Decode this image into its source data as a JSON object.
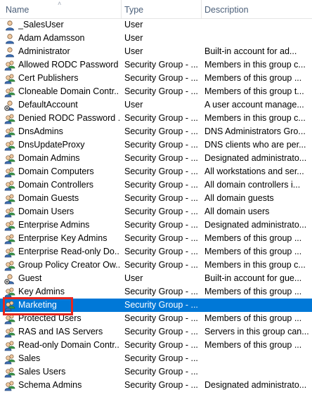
{
  "columns": {
    "name": "Name",
    "type": "Type",
    "description": "Description"
  },
  "colors": {
    "selection": "#0078d7",
    "highlight": "#e8261e",
    "header_text": "#4c607a"
  },
  "rows": [
    {
      "name": "_SalesUser",
      "type": "User",
      "description": "",
      "icon": "user-icon"
    },
    {
      "name": "Adam Adamsson",
      "type": "User",
      "description": "",
      "icon": "user-icon"
    },
    {
      "name": "Administrator",
      "type": "User",
      "description": "Built-in account for ad...",
      "icon": "user-icon"
    },
    {
      "name": "Allowed RODC Password ...",
      "type": "Security Group - ...",
      "description": "Members in this group c...",
      "icon": "group-icon"
    },
    {
      "name": "Cert Publishers",
      "type": "Security Group - ...",
      "description": "Members of this group ...",
      "icon": "group-icon"
    },
    {
      "name": "Cloneable Domain Contr...",
      "type": "Security Group - ...",
      "description": "Members of this group t...",
      "icon": "group-icon"
    },
    {
      "name": "DefaultAccount",
      "type": "User",
      "description": "A user account manage...",
      "icon": "user-disabled-icon"
    },
    {
      "name": "Denied RODC Password ...",
      "type": "Security Group - ...",
      "description": "Members in this group c...",
      "icon": "group-icon"
    },
    {
      "name": "DnsAdmins",
      "type": "Security Group - ...",
      "description": "DNS Administrators Gro...",
      "icon": "group-icon"
    },
    {
      "name": "DnsUpdateProxy",
      "type": "Security Group - ...",
      "description": "DNS clients who are per...",
      "icon": "group-icon"
    },
    {
      "name": "Domain Admins",
      "type": "Security Group - ...",
      "description": "Designated administrato...",
      "icon": "group-icon"
    },
    {
      "name": "Domain Computers",
      "type": "Security Group - ...",
      "description": "All workstations and ser...",
      "icon": "group-icon"
    },
    {
      "name": "Domain Controllers",
      "type": "Security Group - ...",
      "description": "All domain controllers i...",
      "icon": "group-icon"
    },
    {
      "name": "Domain Guests",
      "type": "Security Group - ...",
      "description": "All domain guests",
      "icon": "group-icon"
    },
    {
      "name": "Domain Users",
      "type": "Security Group - ...",
      "description": "All domain users",
      "icon": "group-icon"
    },
    {
      "name": "Enterprise Admins",
      "type": "Security Group - ...",
      "description": "Designated administrato...",
      "icon": "group-icon"
    },
    {
      "name": "Enterprise Key Admins",
      "type": "Security Group - ...",
      "description": "Members of this group ...",
      "icon": "group-icon"
    },
    {
      "name": "Enterprise Read-only Do...",
      "type": "Security Group - ...",
      "description": "Members of this group ...",
      "icon": "group-icon"
    },
    {
      "name": "Group Policy Creator Ow...",
      "type": "Security Group - ...",
      "description": "Members in this group c...",
      "icon": "group-icon"
    },
    {
      "name": "Guest",
      "type": "User",
      "description": "Built-in account for gue...",
      "icon": "user-disabled-icon"
    },
    {
      "name": "Key Admins",
      "type": "Security Group - ...",
      "description": "Members of this group ...",
      "icon": "group-icon"
    },
    {
      "name": "Marketing",
      "type": "Security Group - ...",
      "description": "",
      "icon": "group-icon",
      "selected": true
    },
    {
      "name": "Protected Users",
      "type": "Security Group - ...",
      "description": "Members of this group ...",
      "icon": "group-icon"
    },
    {
      "name": "RAS and IAS Servers",
      "type": "Security Group - ...",
      "description": "Servers in this group can...",
      "icon": "group-icon"
    },
    {
      "name": "Read-only Domain Contr...",
      "type": "Security Group - ...",
      "description": "Members of this group ...",
      "icon": "group-icon"
    },
    {
      "name": "Sales",
      "type": "Security Group - ...",
      "description": "",
      "icon": "group-icon"
    },
    {
      "name": "Sales Users",
      "type": "Security Group - ...",
      "description": "",
      "icon": "group-icon"
    },
    {
      "name": "Schema Admins",
      "type": "Security Group - ...",
      "description": "Designated administrato...",
      "icon": "group-icon"
    }
  ]
}
